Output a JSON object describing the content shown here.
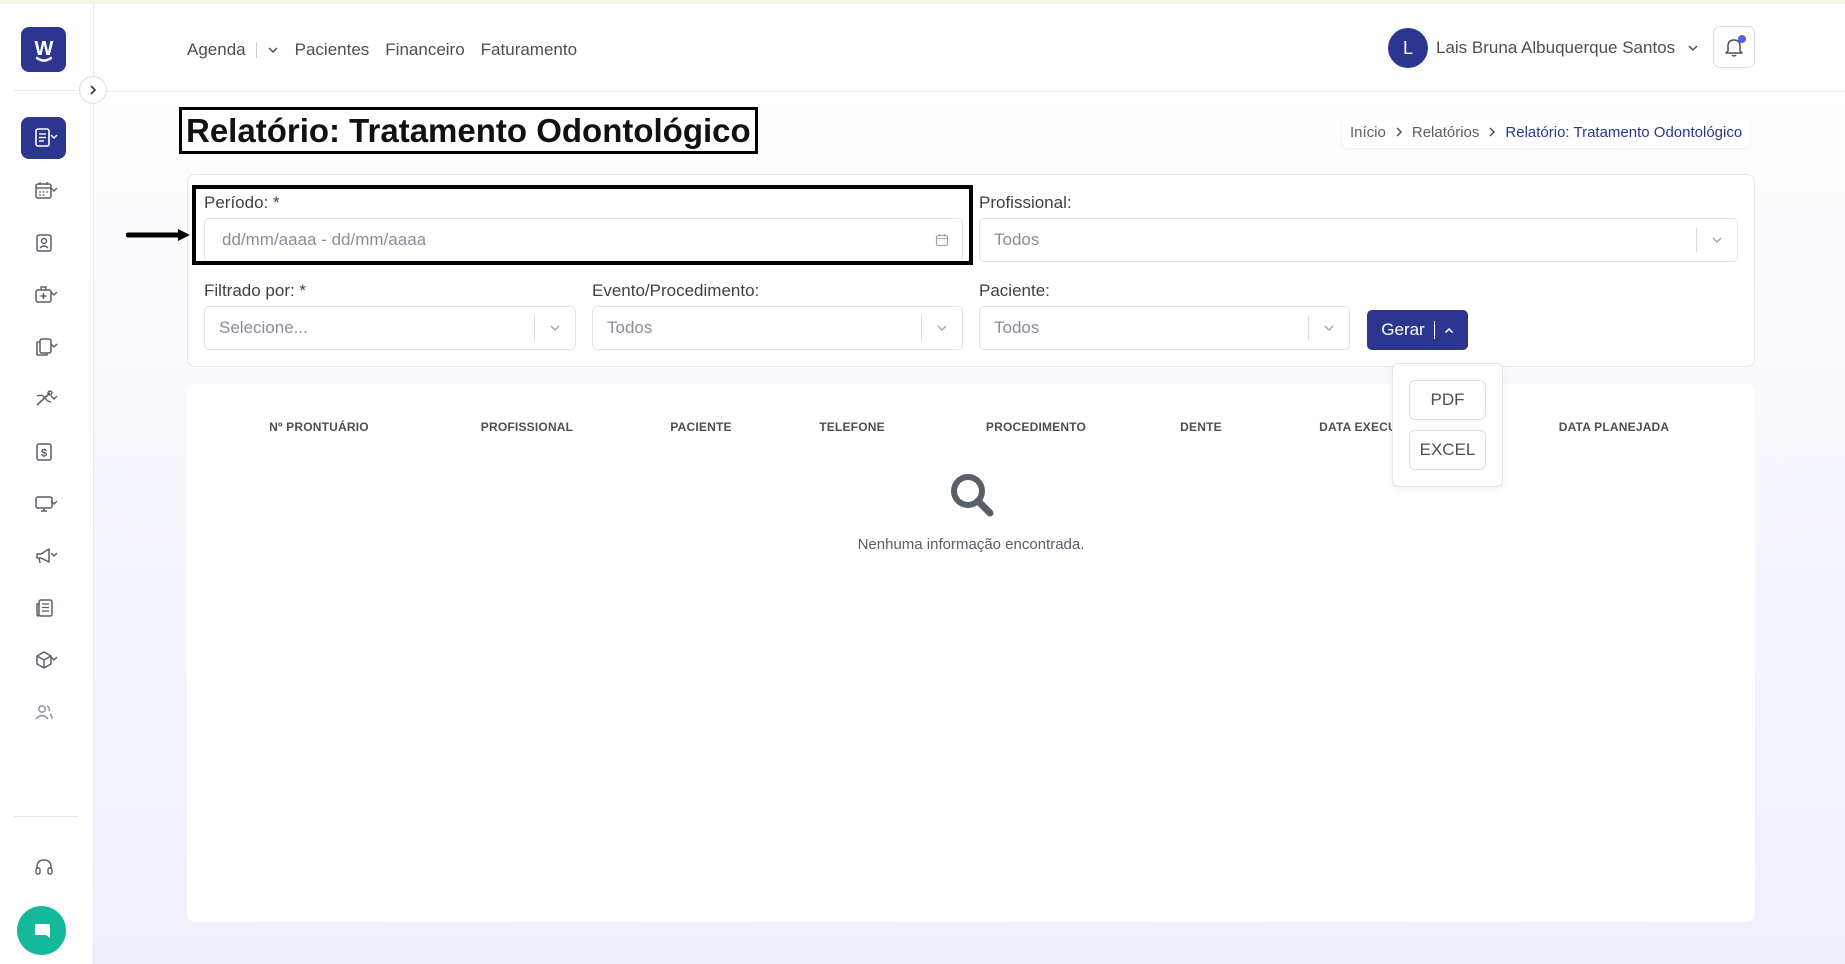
{
  "app": {
    "logo_letter": "W"
  },
  "nav": {
    "items": [
      "Agenda",
      "Pacientes",
      "Financeiro",
      "Faturamento"
    ]
  },
  "user": {
    "initial": "L",
    "name": "Lais Bruna Albuquerque Santos"
  },
  "page": {
    "title": "Relatório: Tratamento Odontológico"
  },
  "breadcrumb": [
    "Início",
    "Relatórios",
    "Relatório: Tratamento Odontológico"
  ],
  "filters": {
    "periodo": {
      "label": "Período: *",
      "placeholder": "dd/mm/aaaa - dd/mm/aaaa"
    },
    "profissional": {
      "label": "Profissional:",
      "value": "Todos"
    },
    "filtrado_por": {
      "label": "Filtrado por: *",
      "value": "Selecione..."
    },
    "evento": {
      "label": "Evento/Procedimento:",
      "value": "Todos"
    },
    "paciente": {
      "label": "Paciente:",
      "value": "Todos"
    }
  },
  "gerar": {
    "label": "Gerar",
    "options": [
      "PDF",
      "EXCEL"
    ]
  },
  "table": {
    "columns": [
      "Nº PRONTUÁRIO",
      "PROFISSIONAL",
      "PACIENTE",
      "TELEFONE",
      "PROCEDIMENTO",
      "DENTE",
      "DATA EXECU",
      "DATA PLANEJADA"
    ],
    "empty_message": "Nenhuma informação encontrada."
  },
  "colors": {
    "primary": "#2c3590",
    "chat": "#14b89a",
    "notification_dot": "#5b5bf0"
  },
  "sidebar": {
    "icons": [
      "reports-icon",
      "calendar-icon",
      "patient-card-icon",
      "clinic-icon",
      "documents-icon",
      "dental-tools-icon",
      "finance-icon",
      "monitor-icon",
      "megaphone-icon",
      "news-icon",
      "box-icon",
      "users-icon",
      "headset-icon",
      "chat-icon"
    ]
  }
}
